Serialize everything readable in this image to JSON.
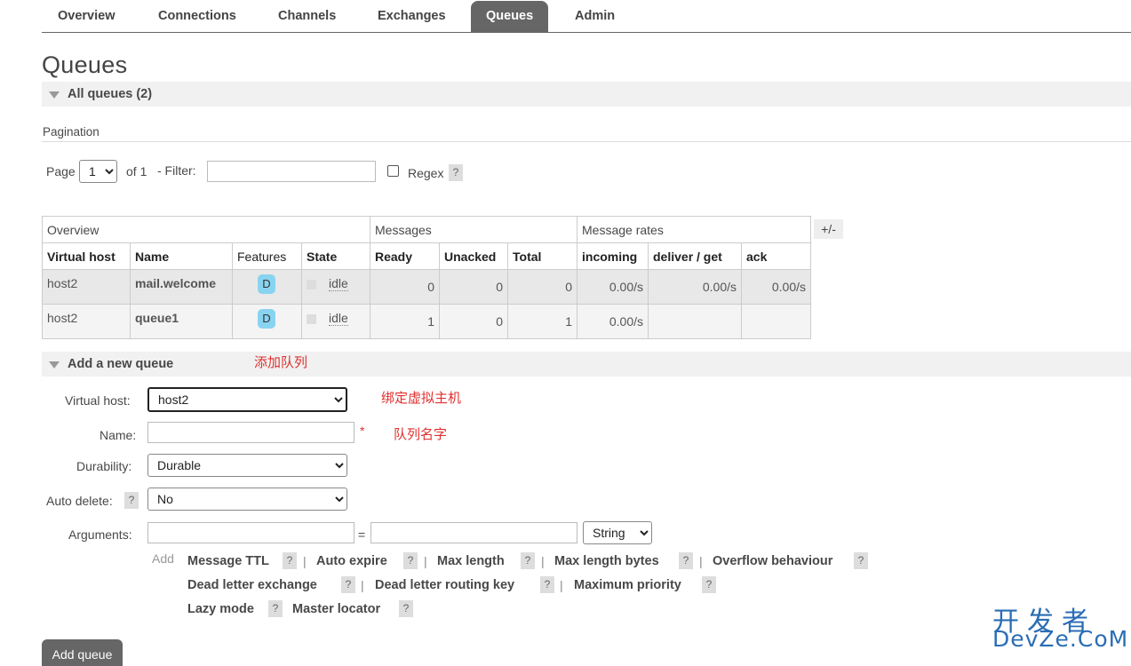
{
  "nav": {
    "tabs": [
      {
        "label": "Overview",
        "active": false
      },
      {
        "label": "Connections",
        "active": false
      },
      {
        "label": "Channels",
        "active": false
      },
      {
        "label": "Exchanges",
        "active": false
      },
      {
        "label": "Queues",
        "active": true
      },
      {
        "label": "Admin",
        "active": false
      }
    ]
  },
  "page_title": "Queues",
  "all_queues": {
    "title": "All queues (2)",
    "pagination_label": "Pagination",
    "page_label": "Page",
    "page_value": "1",
    "of_label": "of 1",
    "filter_label": "- Filter:",
    "filter_value": "",
    "regex_label": "Regex",
    "regex_checked": false,
    "help": "?"
  },
  "table": {
    "groups": [
      "Overview",
      "Messages",
      "Message rates"
    ],
    "columns": [
      "Virtual host",
      "Name",
      "Features",
      "State",
      "Ready",
      "Unacked",
      "Total",
      "incoming",
      "deliver / get",
      "ack"
    ],
    "toggle": "+/-",
    "rows": [
      {
        "vhost": "host2",
        "name": "mail.welcome",
        "feature": "D",
        "state": "idle",
        "ready": "0",
        "unacked": "0",
        "total": "0",
        "incoming": "0.00/s",
        "deliver": "0.00/s",
        "ack": "0.00/s"
      },
      {
        "vhost": "host2",
        "name": "queue1",
        "feature": "D",
        "state": "idle",
        "ready": "1",
        "unacked": "0",
        "total": "1",
        "incoming": "0.00/s",
        "deliver": "",
        "ack": ""
      }
    ]
  },
  "add_queue": {
    "title": "Add a new queue",
    "virtual_host_label": "Virtual host:",
    "virtual_host_value": "host2",
    "name_label": "Name:",
    "name_value": "",
    "required_mark": "*",
    "durability_label": "Durability:",
    "durability_value": "Durable",
    "auto_delete_label": "Auto delete:",
    "auto_delete_value": "No",
    "arguments_label": "Arguments:",
    "equals": "=",
    "arg_type_value": "String",
    "add_label": "Add",
    "arg_links": [
      "Message TTL",
      "Auto expire",
      "Max length",
      "Max length bytes",
      "Overflow behaviour",
      "Dead letter exchange",
      "Dead letter routing key",
      "Maximum priority",
      "Lazy mode",
      "Master locator"
    ],
    "separator": "|",
    "submit_label": "Add queue"
  },
  "annotations": {
    "add_queue_note": "添加队列",
    "vhost_note": "绑定虚拟主机",
    "name_note": "队列名字"
  },
  "watermark": {
    "cn": "开发者",
    "en": "DevZe.CoM"
  },
  "colors": {
    "nav_active_bg": "#666666",
    "feature_badge": "#88d4f0",
    "annotation_red": "#e03030",
    "watermark_blue": "#2a6db4"
  }
}
